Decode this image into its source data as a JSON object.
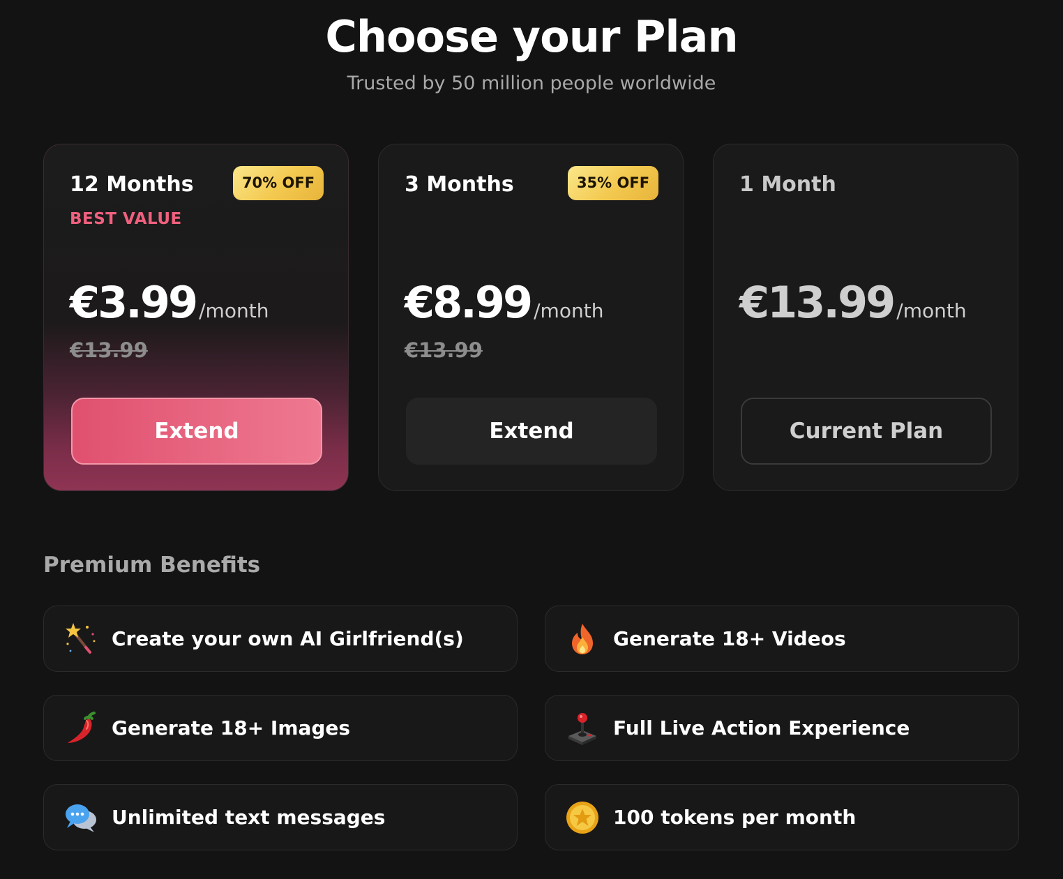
{
  "header": {
    "title": "Choose your Plan",
    "subtitle": "Trusted by 50 million people worldwide"
  },
  "plans": [
    {
      "name": "12 Months",
      "badge": "70% OFF",
      "tag": "BEST VALUE",
      "price": "€3.99",
      "per": "/month",
      "old_price": "€13.99",
      "button": "Extend"
    },
    {
      "name": "3 Months",
      "badge": "35% OFF",
      "price": "€8.99",
      "per": "/month",
      "old_price": "€13.99",
      "button": "Extend"
    },
    {
      "name": "1 Month",
      "price": "€13.99",
      "per": "/month",
      "button": "Current Plan"
    }
  ],
  "benefits": {
    "title": "Premium Benefits",
    "items": [
      {
        "icon": "magic-wand-icon",
        "label": "Create your own AI Girlfriend(s)"
      },
      {
        "icon": "fire-icon",
        "label": "Generate 18+ Videos"
      },
      {
        "icon": "chili-pepper-icon",
        "label": "Generate 18+ Images"
      },
      {
        "icon": "joystick-icon",
        "label": "Full Live Action Experience"
      },
      {
        "icon": "speech-bubbles-icon",
        "label": "Unlimited text messages"
      },
      {
        "icon": "coin-icon",
        "label": "100 tokens per month"
      }
    ]
  },
  "colors": {
    "background": "#131313",
    "accent_pink": "#e0506f",
    "best_value_text": "#f0607e",
    "badge_gold": "#f3c94f"
  }
}
